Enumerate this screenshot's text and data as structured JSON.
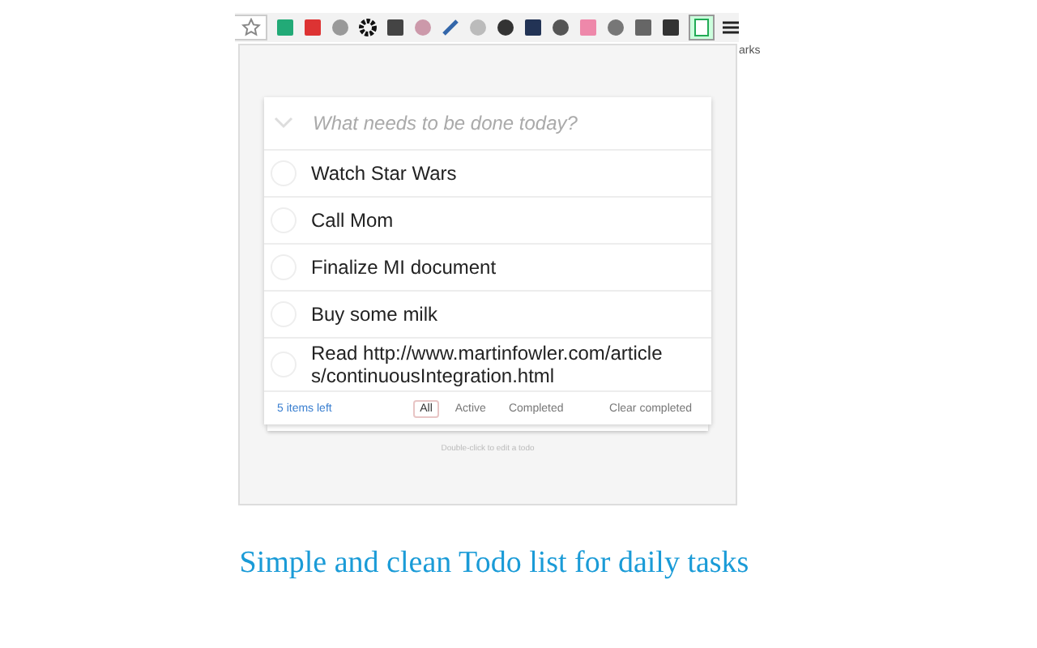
{
  "toolbar": {
    "bookmarks_label": "arks"
  },
  "todo": {
    "new_placeholder": "What needs to be done today?",
    "items": [
      {
        "text": "Watch Star Wars",
        "completed": false
      },
      {
        "text": "Call Mom",
        "completed": false
      },
      {
        "text": "Finalize MI document",
        "completed": false
      },
      {
        "text": "Buy some milk",
        "completed": false
      },
      {
        "text": "Read http://www.martinfowler.com/articles/continuousIntegration.html",
        "completed": false
      }
    ],
    "count": "5 items left",
    "filters": [
      {
        "label": "All",
        "selected": true
      },
      {
        "label": "Active",
        "selected": false
      },
      {
        "label": "Completed",
        "selected": false
      }
    ],
    "clear": "Clear completed",
    "hint": "Double-click to edit a todo"
  },
  "caption": "Simple and clean Todo list for daily tasks"
}
